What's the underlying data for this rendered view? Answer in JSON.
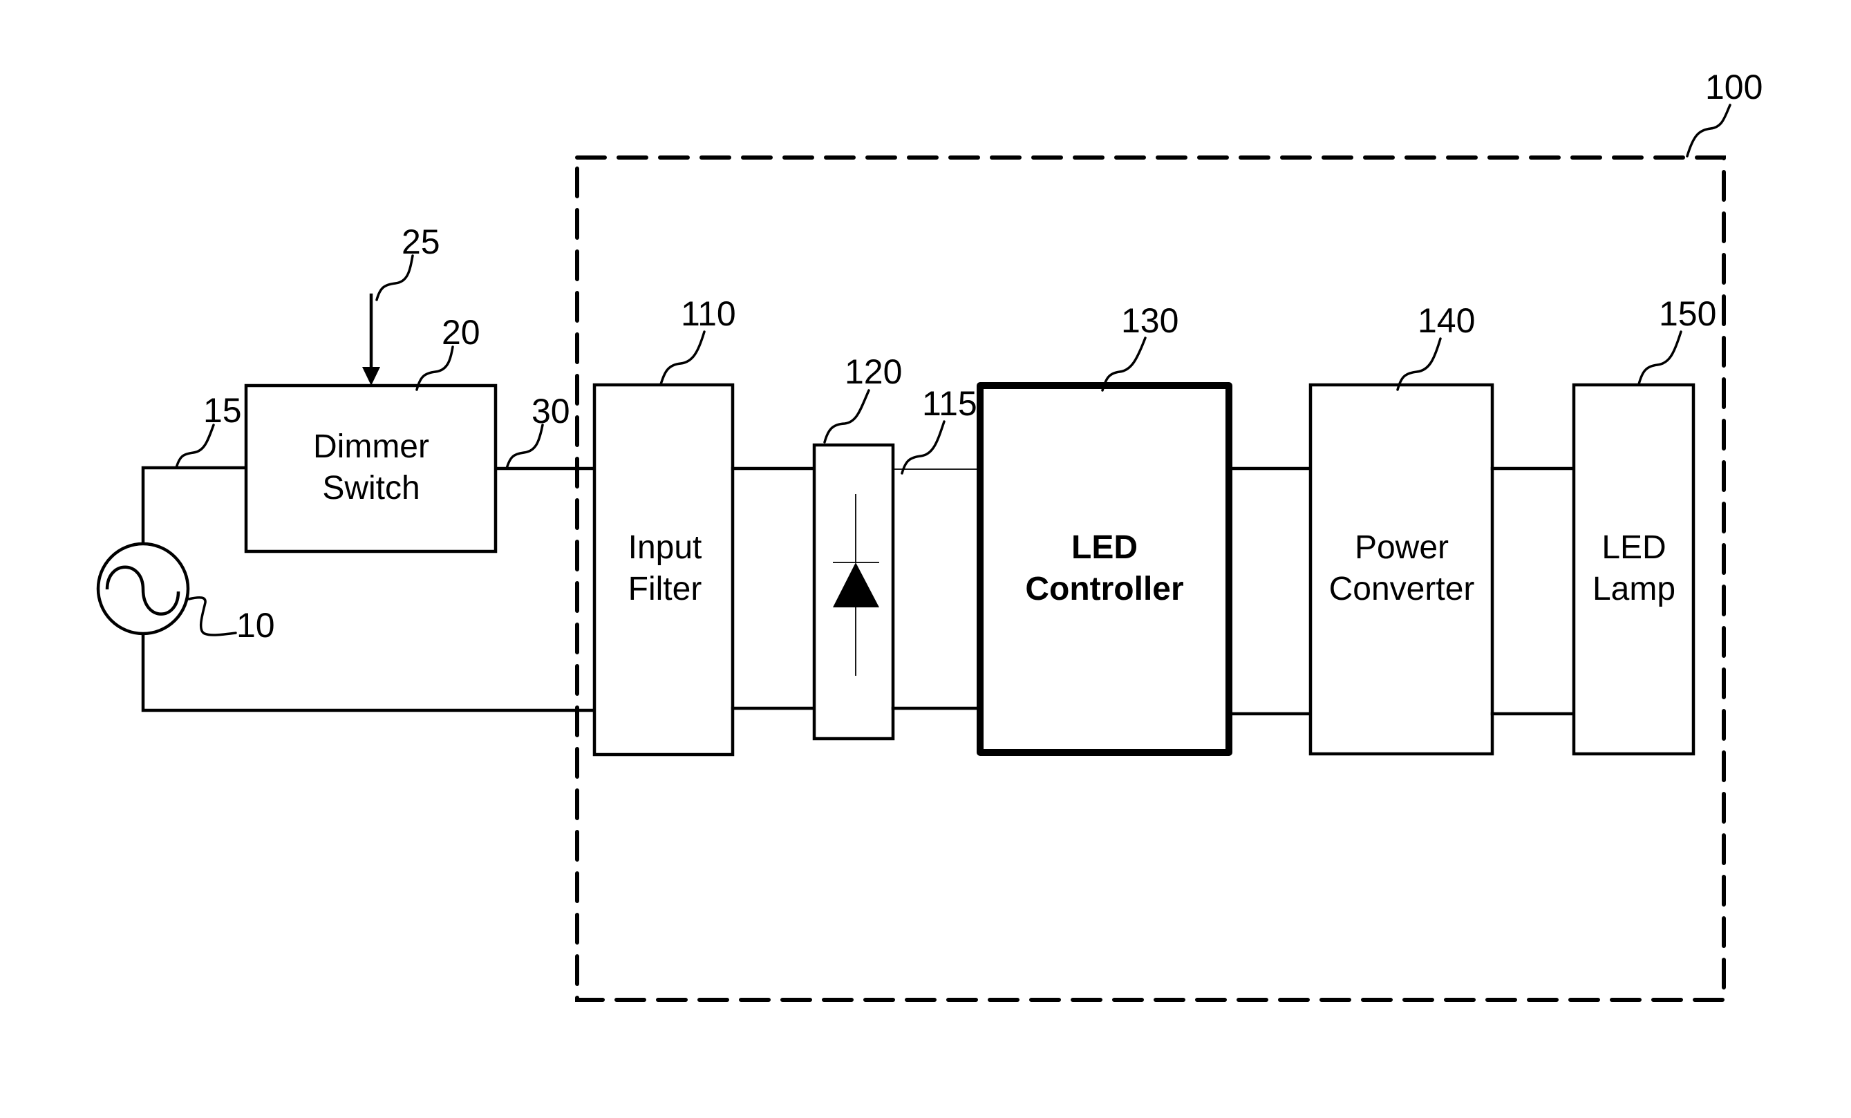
{
  "figure": {
    "type": "block-diagram",
    "colors": {
      "line": "#000000",
      "background": "#ffffff"
    }
  },
  "system": {
    "ref": "100",
    "border_style": "dashed"
  },
  "external": {
    "ac_source": {
      "ref": "10",
      "symbol": "ac-source-icon"
    },
    "input_line": {
      "ref": "15"
    },
    "dimmer_switch": {
      "ref": "20",
      "label_line1": "Dimmer",
      "label_line2": "Switch"
    },
    "dimmer_control": {
      "ref": "25",
      "symbol": "arrow-down-icon"
    },
    "dimmer_output_line": {
      "ref": "30"
    }
  },
  "blocks": [
    {
      "id": "input-filter",
      "ref": "110",
      "line1": "Input",
      "line2": "Filter",
      "bold": false
    },
    {
      "id": "rectifier",
      "ref": "120",
      "symbol": "diode-icon"
    },
    {
      "id": "rectified-line",
      "ref": "115"
    },
    {
      "id": "led-controller",
      "ref": "130",
      "line1": "LED",
      "line2": "Controller",
      "bold": true
    },
    {
      "id": "power-converter",
      "ref": "140",
      "line1": "Power",
      "line2": "Converter",
      "bold": false
    },
    {
      "id": "led-lamp",
      "ref": "150",
      "line1": "LED",
      "line2": "Lamp",
      "bold": false
    }
  ]
}
